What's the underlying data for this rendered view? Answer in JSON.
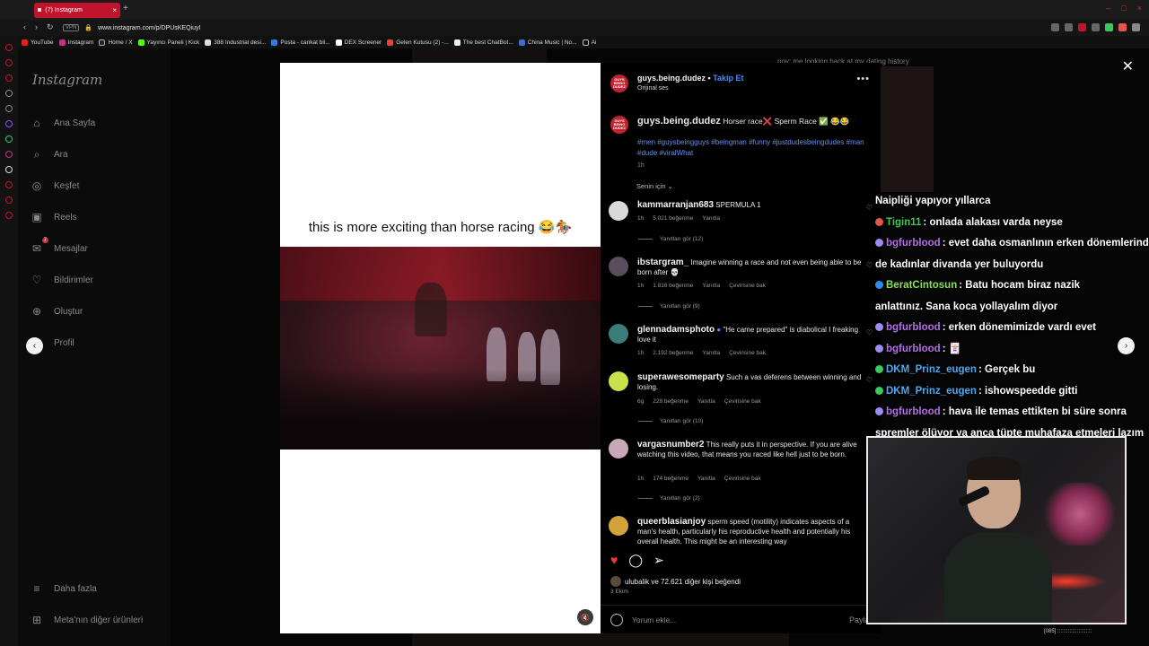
{
  "browser": {
    "tab_title": "(7) Instagram",
    "url": "www.instagram.com/p/DPUsKEQiuyI",
    "vpn_label": "VPN",
    "bookmarks": [
      "YouTube",
      "Instagram",
      "Home / X",
      "Yayıncı Paneli | Kick",
      "388 Industrial desi...",
      "Posta - cankat bil...",
      "DEX Screener",
      "Gelen Kutusu (2) -...",
      "The best ChatBot...",
      "China Music | No...",
      "Ai"
    ]
  },
  "instagram_nav": {
    "logo": "Instagram",
    "items": [
      {
        "label": "Ana Sayfa",
        "icon": "home-icon",
        "glyph": "⌂"
      },
      {
        "label": "Ara",
        "icon": "search-icon",
        "glyph": "⌕"
      },
      {
        "label": "Keşfet",
        "icon": "compass-icon",
        "glyph": "◎"
      },
      {
        "label": "Reels",
        "icon": "reels-icon",
        "glyph": "▣"
      },
      {
        "label": "Mesajlar",
        "icon": "messenger-icon",
        "glyph": "✉",
        "badge": "7"
      },
      {
        "label": "Bildirimler",
        "icon": "heart-icon",
        "glyph": "♡"
      },
      {
        "label": "Oluştur",
        "icon": "plus-icon",
        "glyph": "⊕"
      },
      {
        "label": "Profil",
        "icon": "profile-icon",
        "glyph": "○"
      }
    ],
    "more": "Daha fazla",
    "meta_products": "Meta'nın diğer ürünleri"
  },
  "post": {
    "overlay_text": "this is more exciting than horse racing 😂🏇",
    "author": "guys.being.dudez",
    "follow_label": "Takip Et",
    "audio_label": "Orijinal ses",
    "avatar_text": "GUYS BEING DUDEZ",
    "caption": "Horser race❌ Sperm Race ✅ 😂😂",
    "hashtags": "#men #guysbeingguys #beingman #funny #justdudesbeingdudes #man #dude #viralWhat",
    "caption_time": "1h",
    "sort_label": "Senin için",
    "likes_text": "ulubalik ve 72.621 diğer kişi beğendi",
    "date": "3 Ekim",
    "comment_placeholder": "Yorum ekle...",
    "share_label": "Paylaş"
  },
  "comments": [
    {
      "user": "kammarranjan683",
      "text": "SPERMULA 1",
      "time": "1h",
      "likes": "5.021 beğenme",
      "reply": "Yanıtla",
      "translate": "",
      "replies": "Yanıtları gör (12)",
      "avatar_color": "#d9d9d9"
    },
    {
      "user": "ibstargram_",
      "text": "Imagine winning a race and not even being able to be born after 💀",
      "time": "1h",
      "likes": "1.816 beğenme",
      "reply": "Yanıtla",
      "translate": "Çevirisine bak",
      "replies": "Yanıtları gör (9)",
      "avatar_color": "#5a4d5e"
    },
    {
      "user": "glennadamsphoto",
      "text": "\"He came prepared\" is diabolical I freaking love it",
      "time": "1h",
      "likes": "2.192 beğenme",
      "reply": "Yanıtla",
      "translate": "Çevirisine bak",
      "replies": "",
      "avatar_color": "#3a7d7a"
    },
    {
      "user": "superawesomeparty",
      "text": "Such a vas deferens between winning and losing.",
      "time": "6g",
      "likes": "228 beğenme",
      "reply": "Yanıtla",
      "translate": "Çevirisine bak",
      "replies": "Yanıtları gör (10)",
      "avatar_color": "#c8e04a"
    },
    {
      "user": "vargasnumber2",
      "text": "This really puts it in perspective. If you are alive watching this video, that means you raced like hell just to be born.",
      "time": "1h",
      "likes": "174 beğenme",
      "reply": "Yanıtla",
      "translate": "Çevirisine bak",
      "replies": "Yanıtları gör (2)",
      "avatar_color": "#c9a7b8"
    },
    {
      "user": "queerblasianjoy",
      "text": "sperm speed (motility) indicates aspects of a man's health, particularly his reproductive health and potentially his overall health. This might be an interesting way",
      "time": "",
      "likes": "",
      "reply": "",
      "translate": "",
      "replies": "",
      "avatar_color": "#d4a23a"
    }
  ],
  "background_caption": "pov: me looking back at my dating history",
  "stream_chat": [
    {
      "user": "",
      "text": "Naipliği yapıyor yıllarca",
      "dot": "",
      "color": "#ffffff"
    },
    {
      "user": "Tigin11",
      "text": ": onlada alakası varda neyse",
      "dot": "#e2574c",
      "color": "#3ac85a"
    },
    {
      "user": "bgfurblood",
      "text": ": evet daha osmanlının erken dönemlerinde",
      "dot": "#9b8cf0",
      "color": "#b46ee6"
    },
    {
      "user": "",
      "text": "de kadınlar divanda yer buluyordu",
      "dot": "",
      "color": "#ffffff"
    },
    {
      "user": "BeratCintosun",
      "text": ": Batu hocam biraz nazik",
      "dot": "#2d8cf0",
      "color": "#8ce05a"
    },
    {
      "user": "",
      "text": "anlattınız. Sana koca yollayalım diyor",
      "dot": "",
      "color": "#ffffff"
    },
    {
      "user": "bgfurblood",
      "text": ": erken dönemimizde vardı evet",
      "dot": "#9b8cf0",
      "color": "#b46ee6"
    },
    {
      "user": "bgfurblood",
      "text": ": 🃏",
      "dot": "#9b8cf0",
      "color": "#b46ee6"
    },
    {
      "user": "DKM_Prinz_eugen",
      "text": ": Gerçek bu",
      "dot": "#3ac85a",
      "color": "#4aa8f0"
    },
    {
      "user": "DKM_Prinz_eugen",
      "text": ": ishowspeedde gitti",
      "dot": "#3ac85a",
      "color": "#4aa8f0"
    },
    {
      "user": "bgfurblood",
      "text": ": hava ile temas ettikten bi süre sonra",
      "dot": "#9b8cf0",
      "color": "#b46ee6"
    },
    {
      "user": "",
      "text": "spremler ölüyor ya anca tüpte muhafaza etmeleri lazım",
      "dot": "",
      "color": "#ffffff"
    }
  ],
  "tray_text": "[085] :::::::::::::::::::::::"
}
